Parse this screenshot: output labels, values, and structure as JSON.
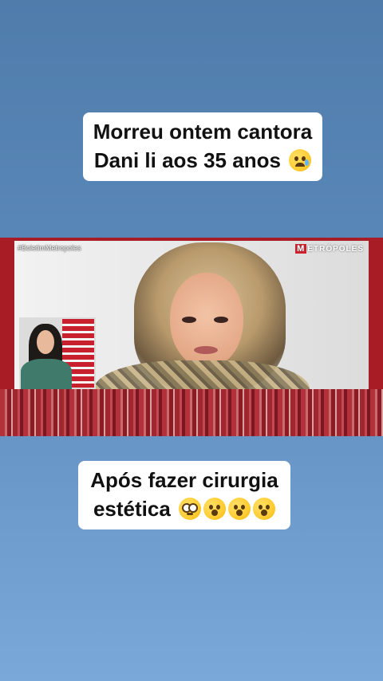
{
  "top_caption": {
    "line1": "Morreu ontem cantora",
    "line2": "Dani li aos 35 anos",
    "emoji": "crying-face-icon"
  },
  "video": {
    "hashtag": "#BoletimMetropoles",
    "brand_initial": "M",
    "brand_rest": "ETRÓPOLES",
    "frame_color": "#a81c26"
  },
  "bottom_caption": {
    "line1": "Após fazer cirurgia",
    "line2": "estética",
    "emojis": [
      "pleading-face-icon",
      "astonished-face-icon",
      "astonished-face-icon",
      "astonished-face-icon"
    ]
  }
}
